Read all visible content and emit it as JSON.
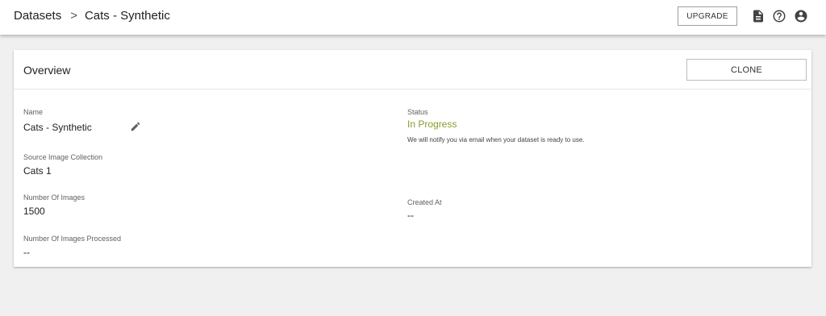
{
  "breadcrumb": {
    "root": "Datasets",
    "separator": ">",
    "current": "Cats - Synthetic"
  },
  "toolbar": {
    "upgrade_label": "UPGRADE",
    "icons": [
      "document-icon",
      "help-icon",
      "account-icon"
    ]
  },
  "overview": {
    "title": "Overview",
    "clone_label": "CLONE",
    "fields": {
      "name": {
        "label": "Name",
        "value": "Cats - Synthetic"
      },
      "source": {
        "label": "Source Image Collection",
        "value": "Cats 1"
      },
      "num_images": {
        "label": "Number Of Images",
        "value": "1500"
      },
      "num_processed": {
        "label": "Number Of Images Processed",
        "value": "--"
      },
      "status": {
        "label": "Status",
        "value": "In Progress",
        "note": "We will notify you via email when your dataset is ready to use."
      },
      "created_at": {
        "label": "Created At",
        "value": "--"
      }
    }
  },
  "colors": {
    "status_in_progress": "#8a9a2e",
    "background": "#f0f0f0",
    "card": "#ffffff"
  }
}
